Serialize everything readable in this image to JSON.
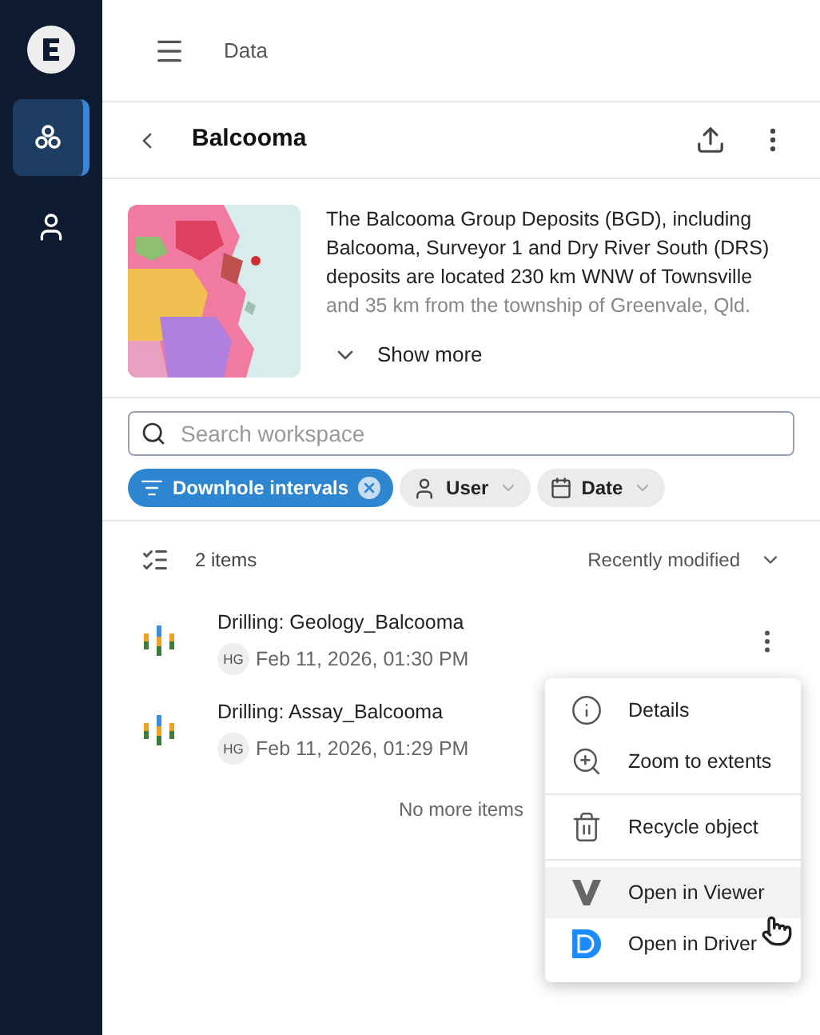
{
  "sidebar": {
    "items": [
      {
        "kind": "workspaces",
        "selected": true
      },
      {
        "kind": "account",
        "selected": false
      }
    ]
  },
  "top_bar": {
    "title": "Data"
  },
  "header": {
    "title": "Balcooma"
  },
  "description": {
    "lines": [
      "The Balcooma Group Deposits (BGD), including",
      "Balcooma, Surveyor 1 and Dry River South (DRS)",
      "deposits are located 230 km WNW of Townsville",
      "and 35 km from the township of Greenvale, Qld."
    ],
    "show_more": "Show more"
  },
  "search": {
    "placeholder": "Search workspace"
  },
  "filters": [
    {
      "kind": "filter",
      "label": "Downhole intervals",
      "selected": true
    },
    {
      "kind": "user",
      "label": "User",
      "selected": false
    },
    {
      "kind": "date",
      "label": "Date",
      "selected": false
    }
  ],
  "list": {
    "count": "2 items",
    "sort": "Recently modified",
    "items": [
      {
        "name": "Drilling: Geology_Balcooma",
        "initials": "HG",
        "date": "Feb 11, 2026, 01:30 PM"
      },
      {
        "name": "Drilling: Assay_Balcooma",
        "initials": "HG",
        "date": "Feb 11, 2026, 01:29 PM"
      }
    ],
    "footer": "No more items"
  },
  "menu": {
    "groups": [
      [
        {
          "kind": "info",
          "label": "Details",
          "selected": false
        },
        {
          "kind": "zoom",
          "label": "Zoom to extents",
          "selected": false
        }
      ],
      [
        {
          "kind": "recycle",
          "label": "Recycle object",
          "selected": false
        }
      ],
      [
        {
          "kind": "viewer",
          "label": "Open in Viewer",
          "selected": true
        },
        {
          "kind": "driver",
          "label": "Open in Driver",
          "selected": false
        }
      ]
    ]
  }
}
